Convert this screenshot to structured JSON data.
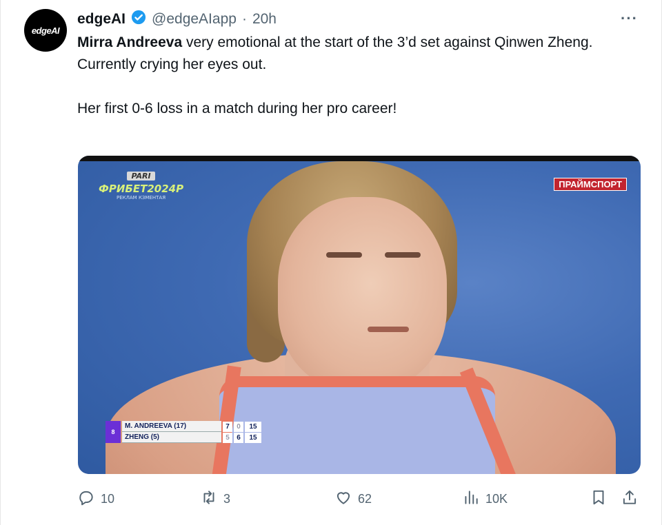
{
  "tweet": {
    "avatar_text": "edgeAI",
    "display_name": "edgeAI",
    "handle": "@edgeAIapp",
    "separator": "·",
    "time": "20h",
    "more": "···",
    "text": {
      "line1_bold": "Mirra Andreeva",
      "line1_rest": " very emotional at the start of the 3’d set against Qinwen Zheng.",
      "line2": "Currently crying her eyes out.",
      "line3": "Her first 0-6 loss in a match during her pro career!"
    }
  },
  "media": {
    "broadcast_logo_small": "PARI",
    "broadcast_logo_main": "ФРИБЕТ2024Р",
    "broadcast_logo_sub": "РЕКЛАМ КЗМЕНТАЯ",
    "channel_logo": "ПРАЙМСПОРТ",
    "scoreboard": {
      "badge": "8",
      "rows": [
        {
          "name": "M. ANDREEVA (17)",
          "set1": "7",
          "set2": "0",
          "points": "15"
        },
        {
          "name": "ZHENG (5)",
          "set1": "5",
          "set2": "6",
          "points": "15"
        }
      ]
    }
  },
  "actions": {
    "replies": "10",
    "reposts": "3",
    "likes": "62",
    "views": "10K"
  },
  "colors": {
    "verified": "#1d9bf0",
    "secondary_text": "#536471",
    "court_blue": "#3f6ab3"
  }
}
